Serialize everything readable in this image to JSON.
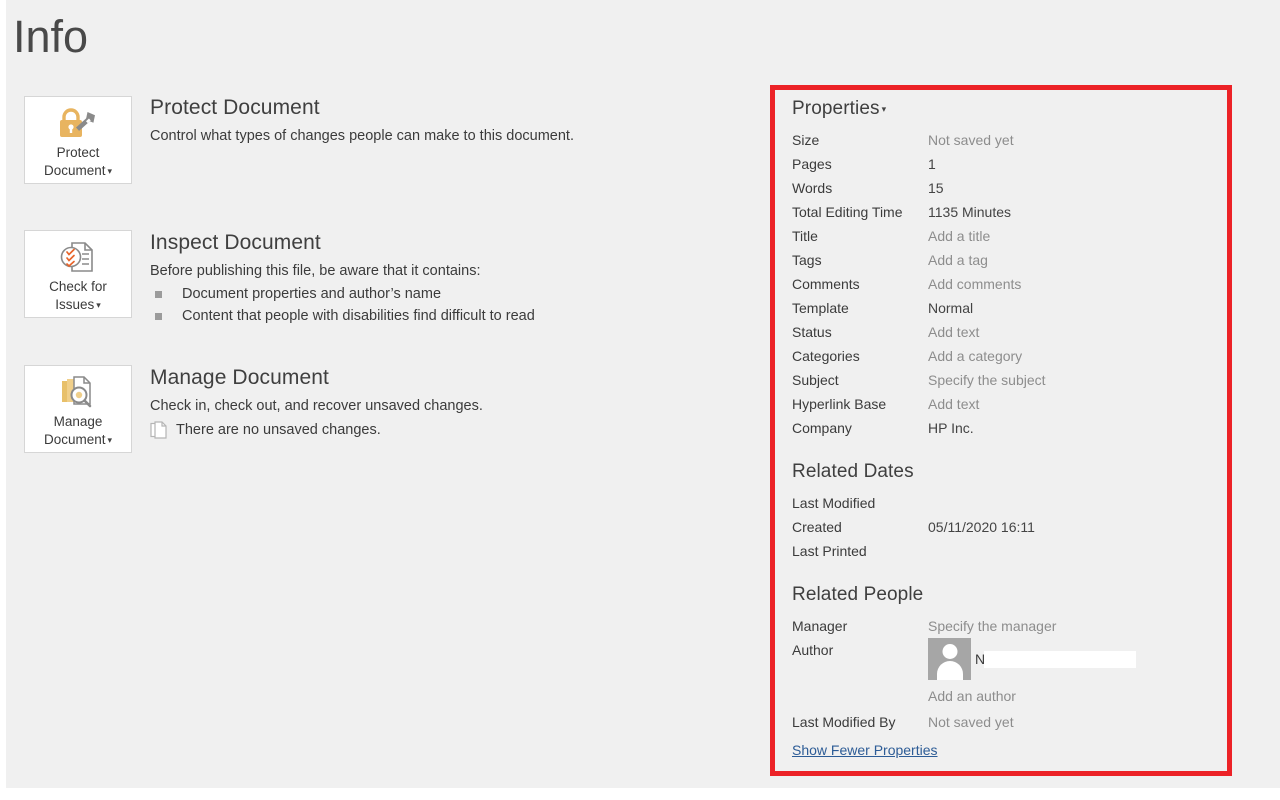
{
  "page": {
    "title": "Info",
    "background_color": "#f0f0f0",
    "highlight_color": "#ec2227"
  },
  "sections": [
    {
      "tile_label": "Protect\nDocument",
      "tile_icon": "lock-and-key-icon",
      "title": "Protect Document",
      "description": "Control what types of changes people can make to this document.",
      "bullets": []
    },
    {
      "tile_label": "Check for\nIssues",
      "tile_icon": "document-checklist-icon",
      "title": "Inspect Document",
      "description": "Before publishing this file, be aware that it contains:",
      "bullets": [
        "Document properties and author’s name",
        "Content that people with disabilities find difficult to read"
      ]
    },
    {
      "tile_label": "Manage\nDocument",
      "tile_icon": "document-stack-magnifier-icon",
      "title": "Manage Document",
      "description": "Check in, check out, and recover unsaved changes.",
      "note_icon": "unsaved-changes-icon",
      "note": "There are no unsaved changes.",
      "bullets": []
    }
  ],
  "properties_pane": {
    "heading": "Properties",
    "heading_caret": "▾",
    "rows": [
      {
        "label": "Size",
        "value": "Not saved yet",
        "placeholder": true
      },
      {
        "label": "Pages",
        "value": "1",
        "placeholder": false
      },
      {
        "label": "Words",
        "value": "15",
        "placeholder": false
      },
      {
        "label": "Total Editing Time",
        "value": "1135 Minutes",
        "placeholder": false
      },
      {
        "label": "Title",
        "value": "Add a title",
        "placeholder": true
      },
      {
        "label": "Tags",
        "value": "Add a tag",
        "placeholder": true
      },
      {
        "label": "Comments",
        "value": "Add comments",
        "placeholder": true
      },
      {
        "label": "Template",
        "value": "Normal",
        "placeholder": false
      },
      {
        "label": "Status",
        "value": "Add text",
        "placeholder": true
      },
      {
        "label": "Categories",
        "value": "Add a category",
        "placeholder": true
      },
      {
        "label": "Subject",
        "value": "Specify the subject",
        "placeholder": true
      },
      {
        "label": "Hyperlink Base",
        "value": "Add text",
        "placeholder": true
      },
      {
        "label": "Company",
        "value": "HP Inc.",
        "placeholder": false
      }
    ],
    "related_dates": {
      "heading": "Related Dates",
      "rows": [
        {
          "label": "Last Modified",
          "value": ""
        },
        {
          "label": "Created",
          "value": "05/11/2020 16:11"
        },
        {
          "label": "Last Printed",
          "value": ""
        }
      ]
    },
    "related_people": {
      "heading": "Related People",
      "manager_label": "Manager",
      "manager_value": "Specify the manager",
      "author_label": "Author",
      "author_name": "N",
      "author_avatar_icon": "person-avatar-icon",
      "add_author": "Add an author",
      "last_modified_by_label": "Last Modified By",
      "last_modified_by_value": "Not saved yet"
    },
    "show_fewer_link": "Show Fewer Properties"
  }
}
